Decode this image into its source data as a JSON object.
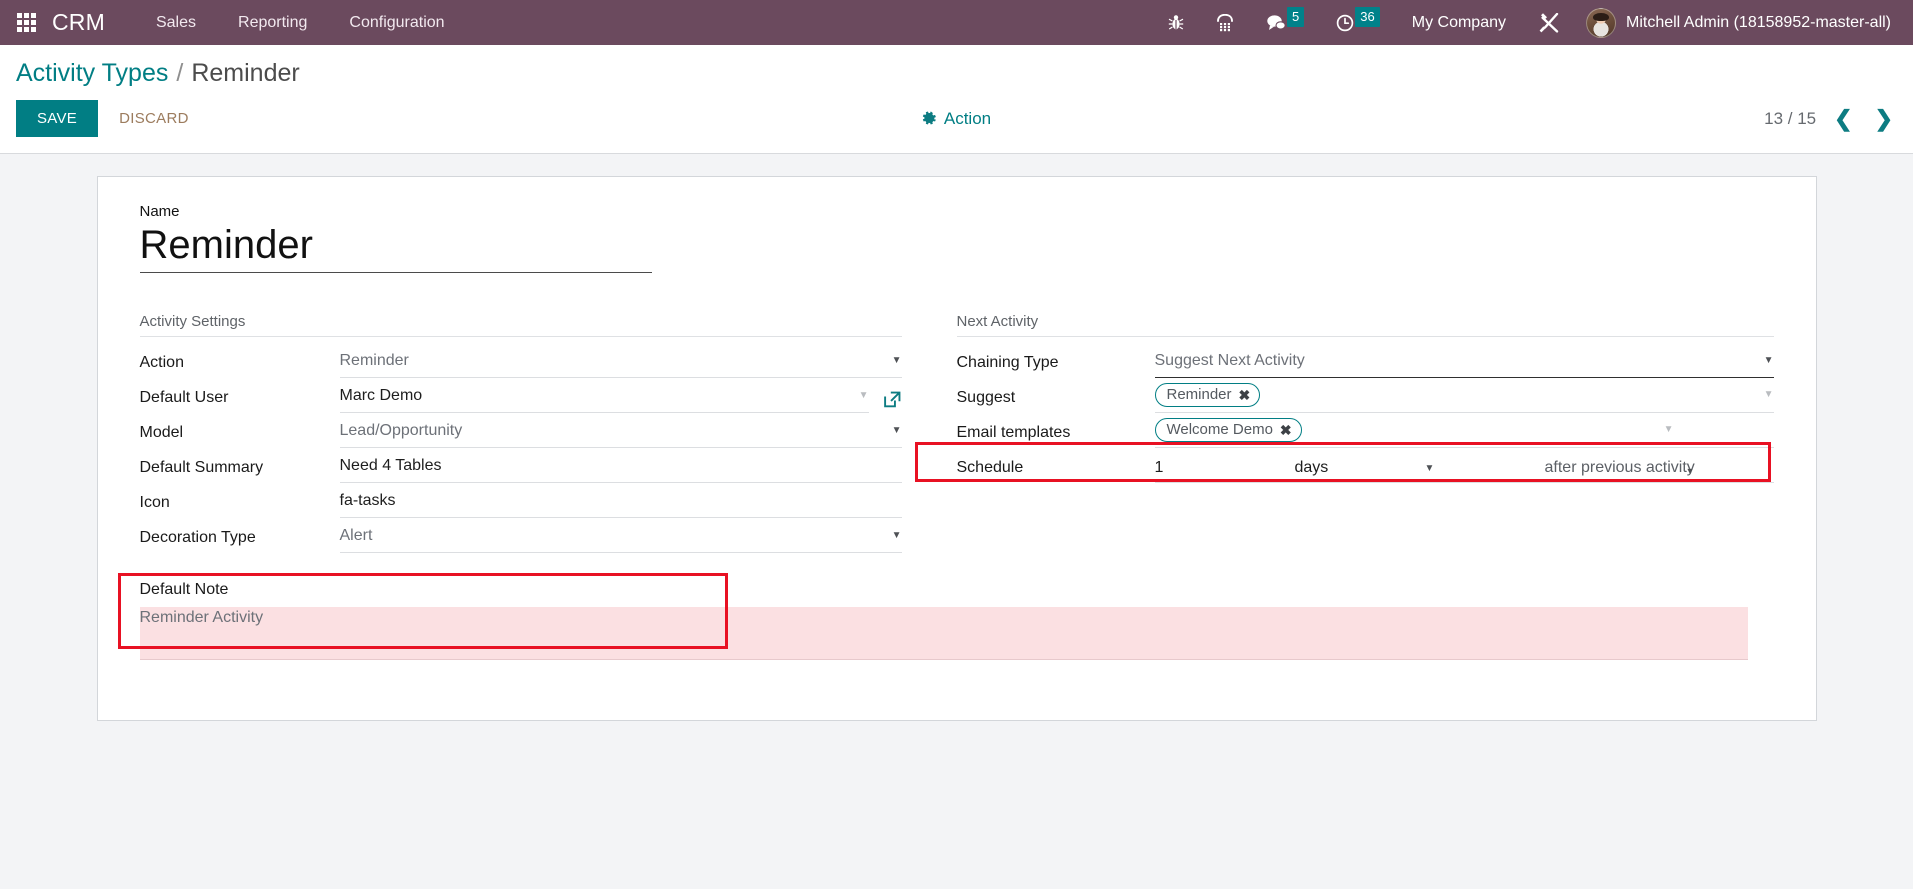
{
  "navbar": {
    "apps_icon": "grid-apps-icon",
    "brand": "CRM",
    "menu": [
      {
        "label": "Sales"
      },
      {
        "label": "Reporting"
      },
      {
        "label": "Configuration"
      }
    ],
    "icons": [
      {
        "name": "bug-icon",
        "label": ""
      },
      {
        "name": "dialpad-phone-icon",
        "label": ""
      }
    ],
    "messages": {
      "icon": "chat-bubble-icon",
      "count": "5"
    },
    "activities": {
      "icon": "clock-icon",
      "count": "36"
    },
    "company": "My Company",
    "tools_icon": "tools-icon",
    "user": "Mitchell Admin (18158952-master-all)",
    "accent": "#00828a",
    "background": "#6b4a5e"
  },
  "control_panel": {
    "breadcrumb": {
      "root": "Activity Types",
      "separator": "/",
      "current": "Reminder"
    },
    "save_label": "SAVE",
    "discard_label": "DISCARD",
    "action_label": "Action",
    "action_icon": "gear-icon",
    "pager": {
      "count": "13 / 15",
      "prev_icon": "chevron-left-icon",
      "next_icon": "chevron-right-icon"
    },
    "accent": "#017e84"
  },
  "form": {
    "name": {
      "label": "Name",
      "value": "Reminder"
    },
    "activity_settings": {
      "title": "Activity Settings",
      "fields": [
        {
          "label": "Action",
          "value": "Reminder",
          "widget": "select",
          "tone": "gray"
        },
        {
          "label": "Default User",
          "value": "Marc Demo",
          "widget": "many2one-link",
          "tone": "dark"
        },
        {
          "label": "Model",
          "value": "Lead/Opportunity",
          "widget": "select",
          "tone": "gray"
        },
        {
          "label": "Default Summary",
          "value": "Need 4 Tables",
          "widget": "text",
          "tone": "dark"
        },
        {
          "label": "Icon",
          "value": "fa-tasks",
          "widget": "text",
          "tone": "dark"
        },
        {
          "label": "Decoration Type",
          "value": "Alert",
          "widget": "select",
          "tone": "gray"
        }
      ]
    },
    "next_activity": {
      "title": "Next Activity",
      "chaining_type": {
        "label": "Chaining Type",
        "value": "Suggest Next Activity"
      },
      "suggest": {
        "label": "Suggest",
        "tags": [
          "Reminder"
        ]
      },
      "email_templates": {
        "label": "Email templates",
        "tags": [
          "Welcome Demo"
        ]
      },
      "schedule": {
        "label": "Schedule",
        "amount": "1",
        "unit": "days",
        "trigger": "after previous activity"
      }
    },
    "default_note": {
      "label": "Default Note",
      "value": "Reminder Activity"
    }
  },
  "highlights": {
    "schedule_box_color": "#e81123",
    "note_box_color": "#e81123"
  }
}
